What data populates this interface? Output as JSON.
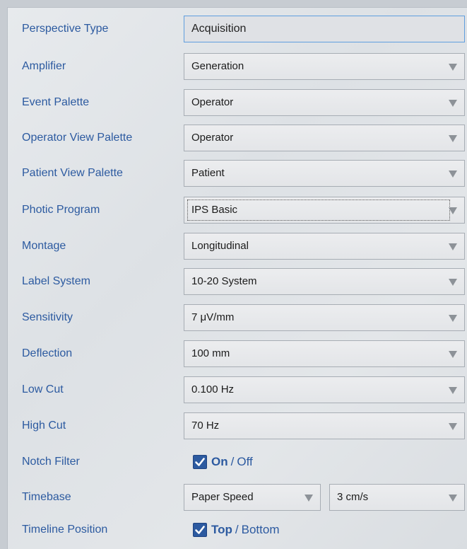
{
  "rows": [
    {
      "label": "Perspective Type",
      "value": "Acquisition"
    },
    {
      "label": "Amplifier",
      "value": "Generation"
    },
    {
      "label": "Event Palette",
      "value": "Operator"
    },
    {
      "label": "Operator View Palette",
      "value": "Operator"
    },
    {
      "label": "Patient View Palette",
      "value": "Patient"
    },
    {
      "label": "Photic Program",
      "value": "IPS Basic"
    },
    {
      "label": "Montage",
      "value": "Longitudinal"
    },
    {
      "label": "Label System",
      "value": "10-20 System"
    },
    {
      "label": "Sensitivity",
      "value": "7 μV/mm"
    },
    {
      "label": "Deflection",
      "value": "100 mm"
    },
    {
      "label": "Low Cut",
      "value": "0.100 Hz"
    },
    {
      "label": "High Cut",
      "value": "70 Hz"
    }
  ],
  "notch": {
    "label": "Notch Filter",
    "checked": true,
    "on": "On",
    "sep": "/",
    "off": "Off"
  },
  "timebase": {
    "label": "Timebase",
    "mode": "Paper Speed",
    "speed": "3 cm/s"
  },
  "timeline": {
    "label": "Timeline Position",
    "checked": true,
    "on": "Top",
    "sep": "/",
    "off": "Bottom"
  },
  "colors": {
    "label": "#2c5aa0",
    "checkbox": "#2c5aa0",
    "focus_border": "#5f9ede"
  },
  "icons": {
    "dropdown": "chevron-down-icon",
    "check": "checkmark-icon"
  }
}
